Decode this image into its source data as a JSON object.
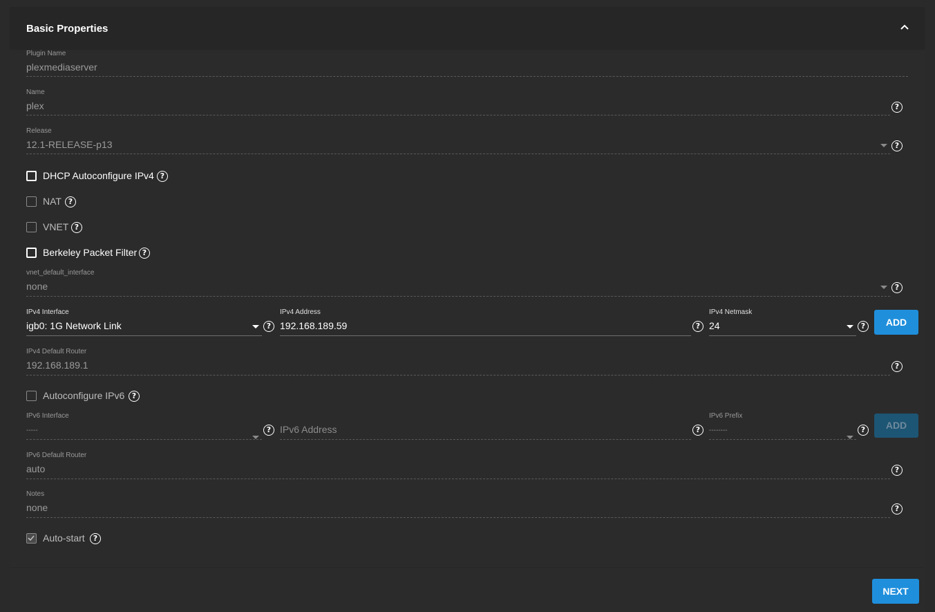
{
  "card": {
    "title": "Basic Properties",
    "collapse_icon": "chevron-up-icon"
  },
  "plugin_name": {
    "label": "Plugin Name",
    "value": "plexmediaserver"
  },
  "name": {
    "label": "Name",
    "value": "plex"
  },
  "release": {
    "label": "Release",
    "value": "12.1-RELEASE-p13"
  },
  "checkboxes": {
    "dhcp": {
      "label": "DHCP Autoconfigure IPv4",
      "checked": false
    },
    "nat": {
      "label": "NAT",
      "checked": false
    },
    "vnet": {
      "label": "VNET",
      "checked": false
    },
    "bpf": {
      "label": "Berkeley Packet Filter",
      "checked": false
    },
    "autoconf_ipv6": {
      "label": "Autoconfigure IPv6",
      "checked": false
    },
    "autostart": {
      "label": "Auto-start",
      "checked": true
    }
  },
  "vnet_default_interface": {
    "label": "vnet_default_interface",
    "value": "none"
  },
  "ipv4": {
    "interface": {
      "label": "IPv4 Interface",
      "value": "igb0: 1G Network Link"
    },
    "address": {
      "label": "IPv4 Address",
      "value": "192.168.189.59"
    },
    "netmask": {
      "label": "IPv4 Netmask",
      "value": "24"
    },
    "add_label": "ADD",
    "default_router": {
      "label": "IPv4 Default Router",
      "value": "192.168.189.1"
    }
  },
  "ipv6": {
    "interface": {
      "label": "IPv6 Interface",
      "value": "-----"
    },
    "address": {
      "placeholder": "IPv6 Address"
    },
    "prefix": {
      "label": "IPv6 Prefix",
      "value": "--------"
    },
    "add_label": "ADD",
    "default_router": {
      "label": "IPv6 Default Router",
      "value": "auto"
    }
  },
  "notes": {
    "label": "Notes",
    "value": "none"
  },
  "help_glyph": "?",
  "footer": {
    "next_label": "NEXT"
  }
}
